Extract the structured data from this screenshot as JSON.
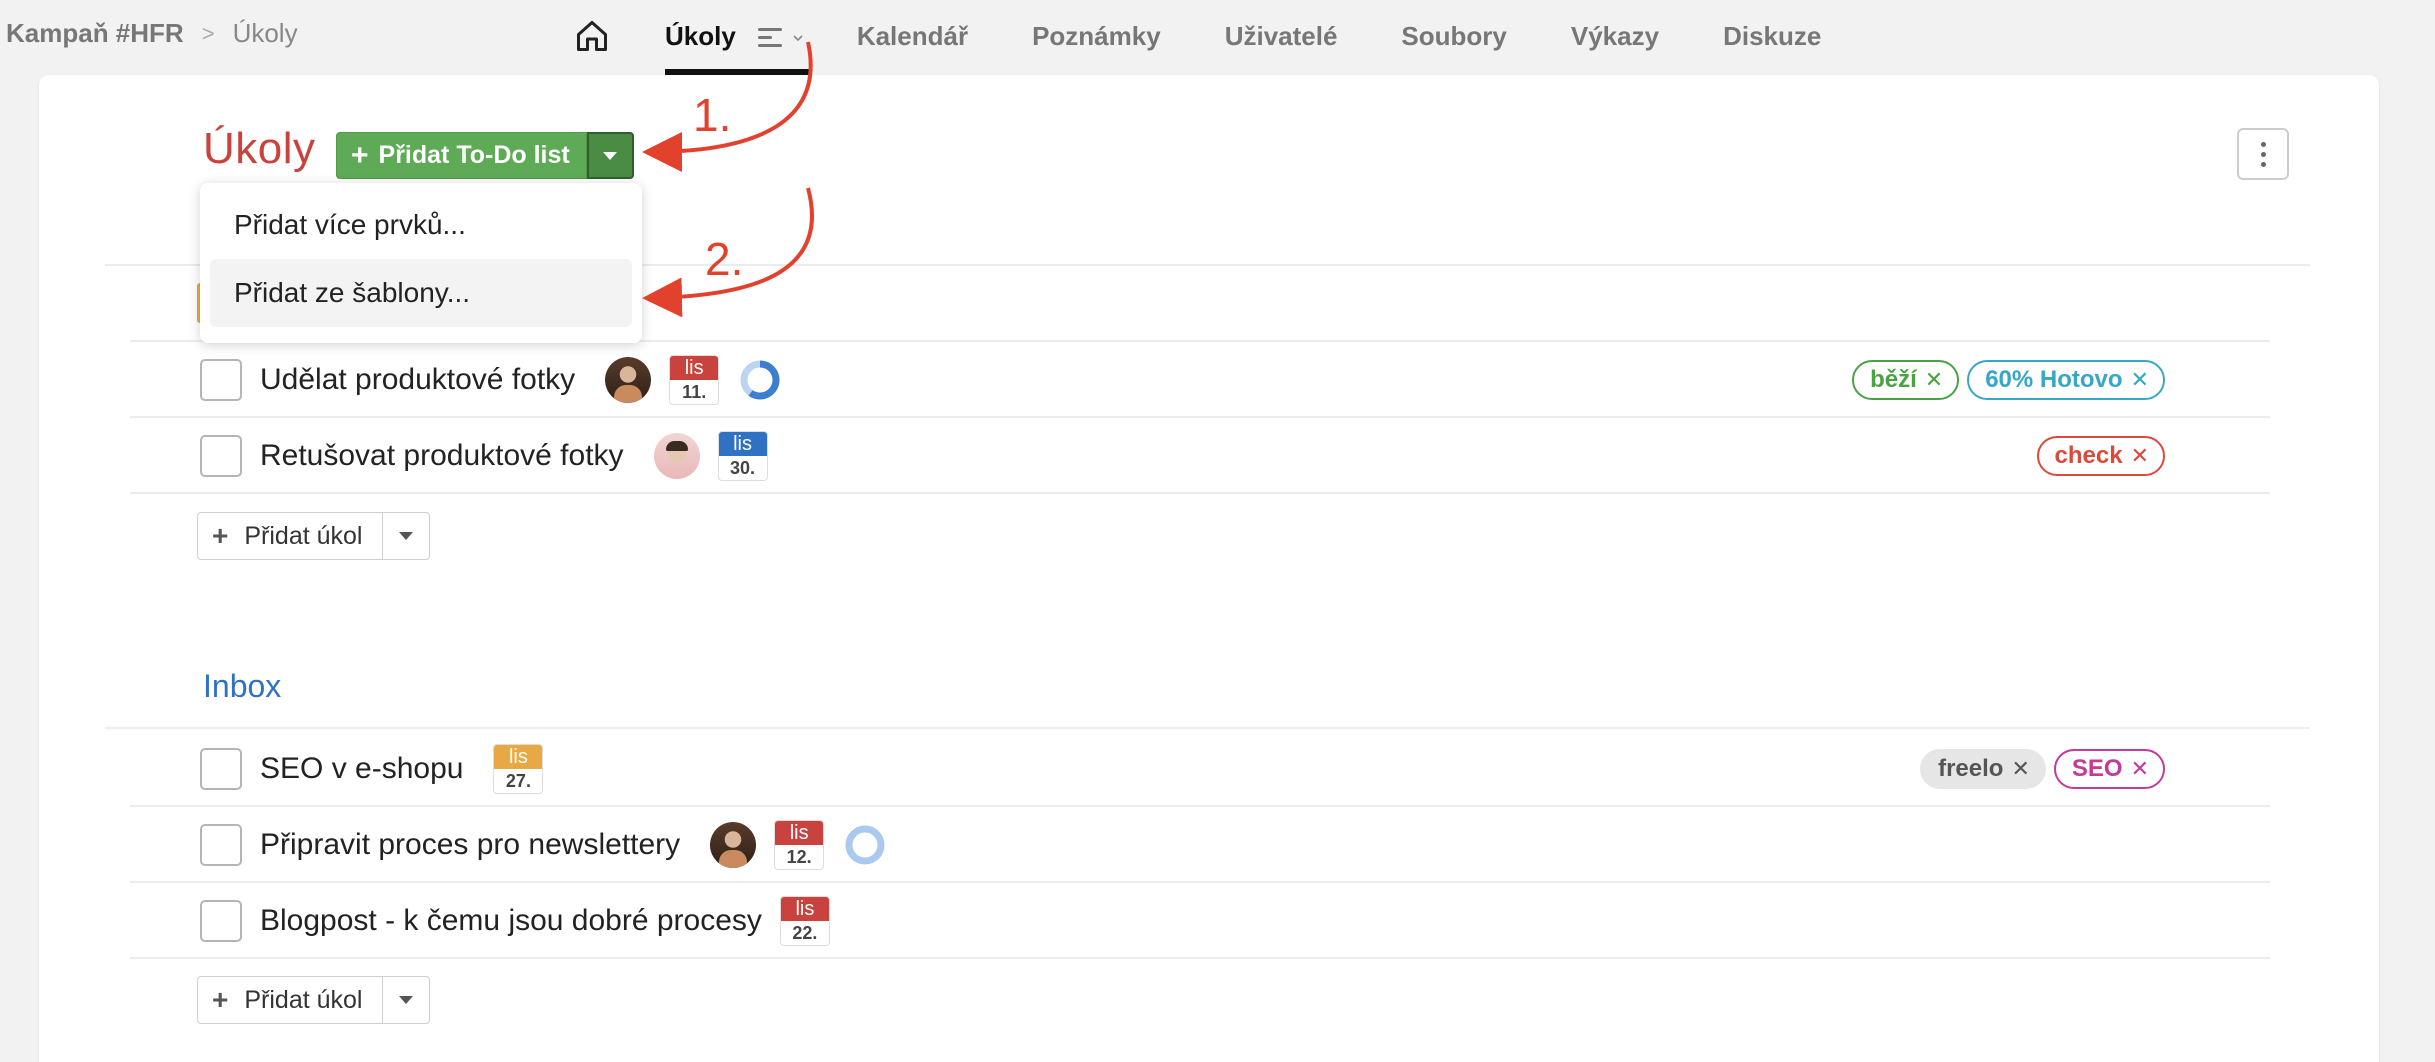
{
  "breadcrumb": {
    "project": "Kampaň #HFR",
    "separator": ">",
    "current": "Úkoly"
  },
  "nav": {
    "home_icon": "home-icon",
    "items": [
      "Úkoly",
      "Kalendář",
      "Poznámky",
      "Uživatelé",
      "Soubory",
      "Výkazy",
      "Diskuze"
    ],
    "active": "Úkoly"
  },
  "page": {
    "title": "Úkoly",
    "add_list_label": "Přidat To-Do list",
    "more_icon": "kebab-menu-icon"
  },
  "dropdown": {
    "items": [
      "Přidat více prvků...",
      "Přidat ze šablony..."
    ],
    "highlighted_index": 1
  },
  "lists": [
    {
      "title": "",
      "tasks": [
        {
          "name": "Udělat produktové fotky",
          "avatar": "user-avatar-1",
          "date": {
            "month": "lis",
            "day": "11.",
            "color": "#c9423e"
          },
          "progress": 0.6,
          "tags": [
            {
              "label": "běží",
              "color": "#4aa244"
            },
            {
              "label": "60% Hotovo",
              "color": "#37a8c4"
            }
          ]
        },
        {
          "name": "Retušovat produktové fotky",
          "avatar": "user-avatar-2",
          "date": {
            "month": "lis",
            "day": "30.",
            "color": "#2f72c4"
          },
          "tags": [
            {
              "label": "check",
              "color": "#d94a3c"
            }
          ]
        }
      ],
      "add_task_label": "Přidat úkol"
    },
    {
      "title": "Inbox",
      "tasks": [
        {
          "name": "SEO v e-shopu",
          "date": {
            "month": "lis",
            "day": "27.",
            "color": "#e8a843"
          },
          "tags": [
            {
              "label": "freelo",
              "color": "#555555",
              "bg": "#e6e6e6"
            },
            {
              "label": "SEO",
              "color": "#c43a9a"
            }
          ]
        },
        {
          "name": "Připravit proces pro newslettery",
          "avatar": "user-avatar-1",
          "date": {
            "month": "lis",
            "day": "12.",
            "color": "#c9423e"
          },
          "progress": 0.0
        },
        {
          "name": "Blogpost - k čemu jsou dobré procesy",
          "date": {
            "month": "lis",
            "day": "22.",
            "color": "#c9423e"
          }
        }
      ],
      "add_task_label": "Přidat úkol"
    }
  ],
  "annotations": {
    "step1": "1.",
    "step2": "2.",
    "color": "#e2412e"
  },
  "colors": {
    "accent_red": "#c9423e",
    "accent_green": "#5eaa56",
    "accent_blue": "#2f72c4"
  }
}
